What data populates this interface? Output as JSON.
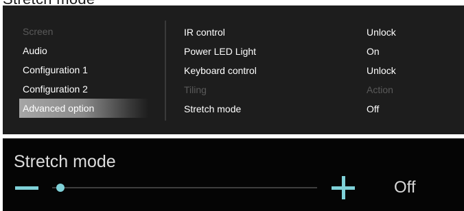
{
  "caption": "Stretch mode",
  "menu": {
    "categories": [
      {
        "label": "Screen",
        "state": "disabled"
      },
      {
        "label": "Audio",
        "state": "normal"
      },
      {
        "label": "Configuration 1",
        "state": "normal"
      },
      {
        "label": "Configuration 2",
        "state": "normal"
      },
      {
        "label": "Advanced option",
        "state": "selected"
      }
    ],
    "settings": [
      {
        "label": "IR control",
        "value": "Unlock",
        "state": "normal"
      },
      {
        "label": "Power LED Light",
        "value": "On",
        "state": "normal"
      },
      {
        "label": "Keyboard control",
        "value": "Unlock",
        "state": "normal"
      },
      {
        "label": "Tiling",
        "value": "Action",
        "state": "disabled"
      },
      {
        "label": "Stretch mode",
        "value": "Off",
        "state": "normal"
      }
    ]
  },
  "slider": {
    "title": "Stretch mode",
    "value_text": "Off",
    "level_fraction": 0.03,
    "accent_color": "#7fd1d8"
  }
}
